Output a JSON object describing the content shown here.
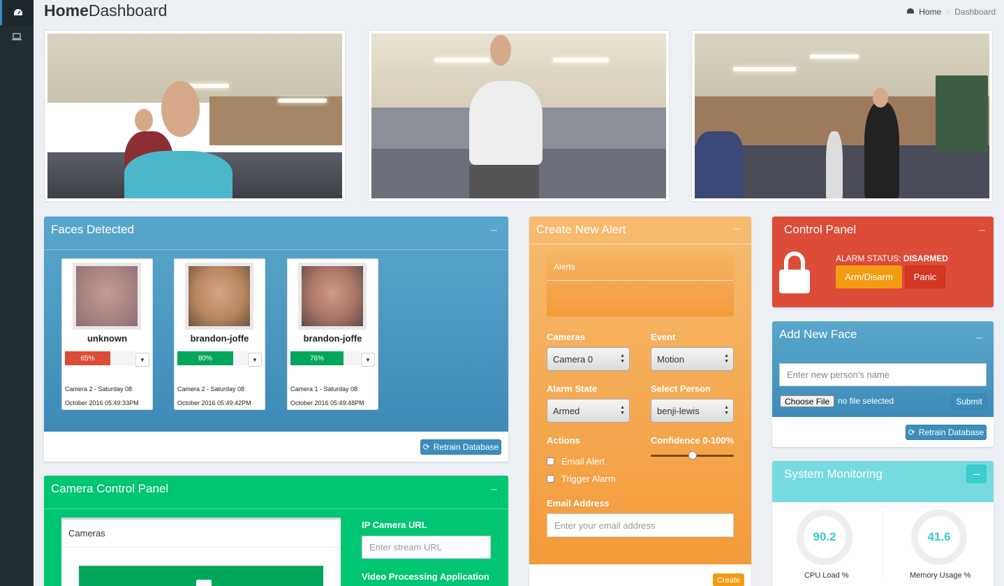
{
  "page": {
    "title_bold": "Home",
    "title_rest": "Dashboard"
  },
  "breadcrumb": {
    "home": "Home",
    "current": "Dashboard"
  },
  "sidebar": {
    "items": [
      {
        "icon": "dashboard-icon",
        "active": true
      },
      {
        "icon": "laptop-icon",
        "active": false
      }
    ]
  },
  "faces_panel": {
    "title": "Faces Detected",
    "faces": [
      {
        "name": "unknown",
        "confidence": "65%",
        "confidence_value": 65,
        "bar_color": "#dd4b39",
        "camera_line": "Camera 2 - Saturday 08",
        "time_line": "October 2016 05:49:33PM"
      },
      {
        "name": "brandon-joffe",
        "confidence": "80%",
        "confidence_value": 80,
        "bar_color": "#00a65a",
        "camera_line": "Camera 2 - Saturday 08",
        "time_line": "October 2016 05:49:42PM"
      },
      {
        "name": "brandon-joffe",
        "confidence": "76%",
        "confidence_value": 76,
        "bar_color": "#00a65a",
        "camera_line": "Camera 1 - Saturday 08",
        "time_line": "October 2016 05:49:48PM"
      }
    ],
    "retrain_label": "Retrain Database"
  },
  "camera_panel": {
    "title": "Camera Control Panel",
    "cameras_label": "Cameras",
    "ip_url_label": "IP Camera URL",
    "ip_url_placeholder": "Enter stream URL",
    "video_app_label": "Video Processing Application"
  },
  "alert_panel": {
    "title": "Create New Alert",
    "alerts_label": "Alerts",
    "cameras_label": "Cameras",
    "cameras_value": "Camera 0",
    "event_label": "Event",
    "event_value": "Motion",
    "alarm_state_label": "Alarm State",
    "alarm_state_value": "Armed",
    "person_label": "Select Person",
    "person_value": "benji-lewis",
    "actions_label": "Actions",
    "confidence_label": "Confidence 0-100%",
    "confidence_value": 50,
    "email_alert_label": "Email Alert",
    "trigger_alarm_label": "Trigger Alarm",
    "email_label": "Email Address",
    "email_placeholder": "Enter your email address",
    "create_label": "Create"
  },
  "control_panel": {
    "title": "Control Panel",
    "status_prefix": "ALARM STATUS:",
    "status_value": "DISARMED",
    "arm_label": "Arm/Disarm",
    "panic_label": "Panic"
  },
  "add_face_panel": {
    "title": "Add New Face",
    "name_placeholder": "Enter new person's name",
    "choose_file_label": "Choose File",
    "no_file_label": "no file selected",
    "submit_label": "Submit",
    "retrain_label": "Retrain Database"
  },
  "monitoring_panel": {
    "title": "System Monitoring",
    "cpu_value": "90.2",
    "cpu_label": "CPU Load %",
    "memory_value": "41.6",
    "memory_label": "Memory Usage %"
  },
  "colors": {
    "blue": "#3c8dbc",
    "green": "#00c572",
    "orange": "#f39c12",
    "red": "#dd4b39",
    "teal": "#39cccc"
  }
}
